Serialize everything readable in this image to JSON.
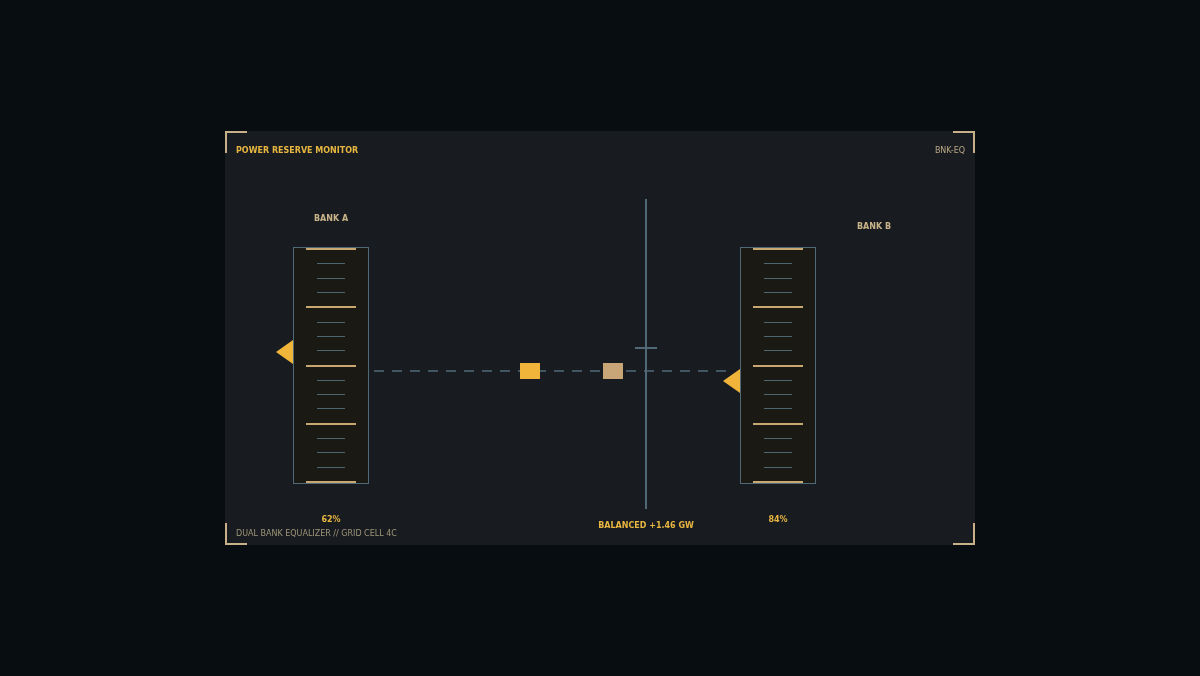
{
  "header": {
    "title": "POWER RESERVE MONITOR",
    "code": "BNK-EQ"
  },
  "banks": [
    {
      "label": "BANK A",
      "level": 0.56,
      "reading": "62%"
    },
    {
      "label": "BANK B",
      "level": 0.44,
      "reading": "84%"
    }
  ],
  "balance": {
    "markers": [
      {
        "color": "#f0b43a"
      },
      {
        "color": "#c9a678"
      }
    ],
    "reading": "BALANCED +1.46 GW"
  },
  "footer": "DUAL BANK EQUALIZER // GRID CELL 4C"
}
